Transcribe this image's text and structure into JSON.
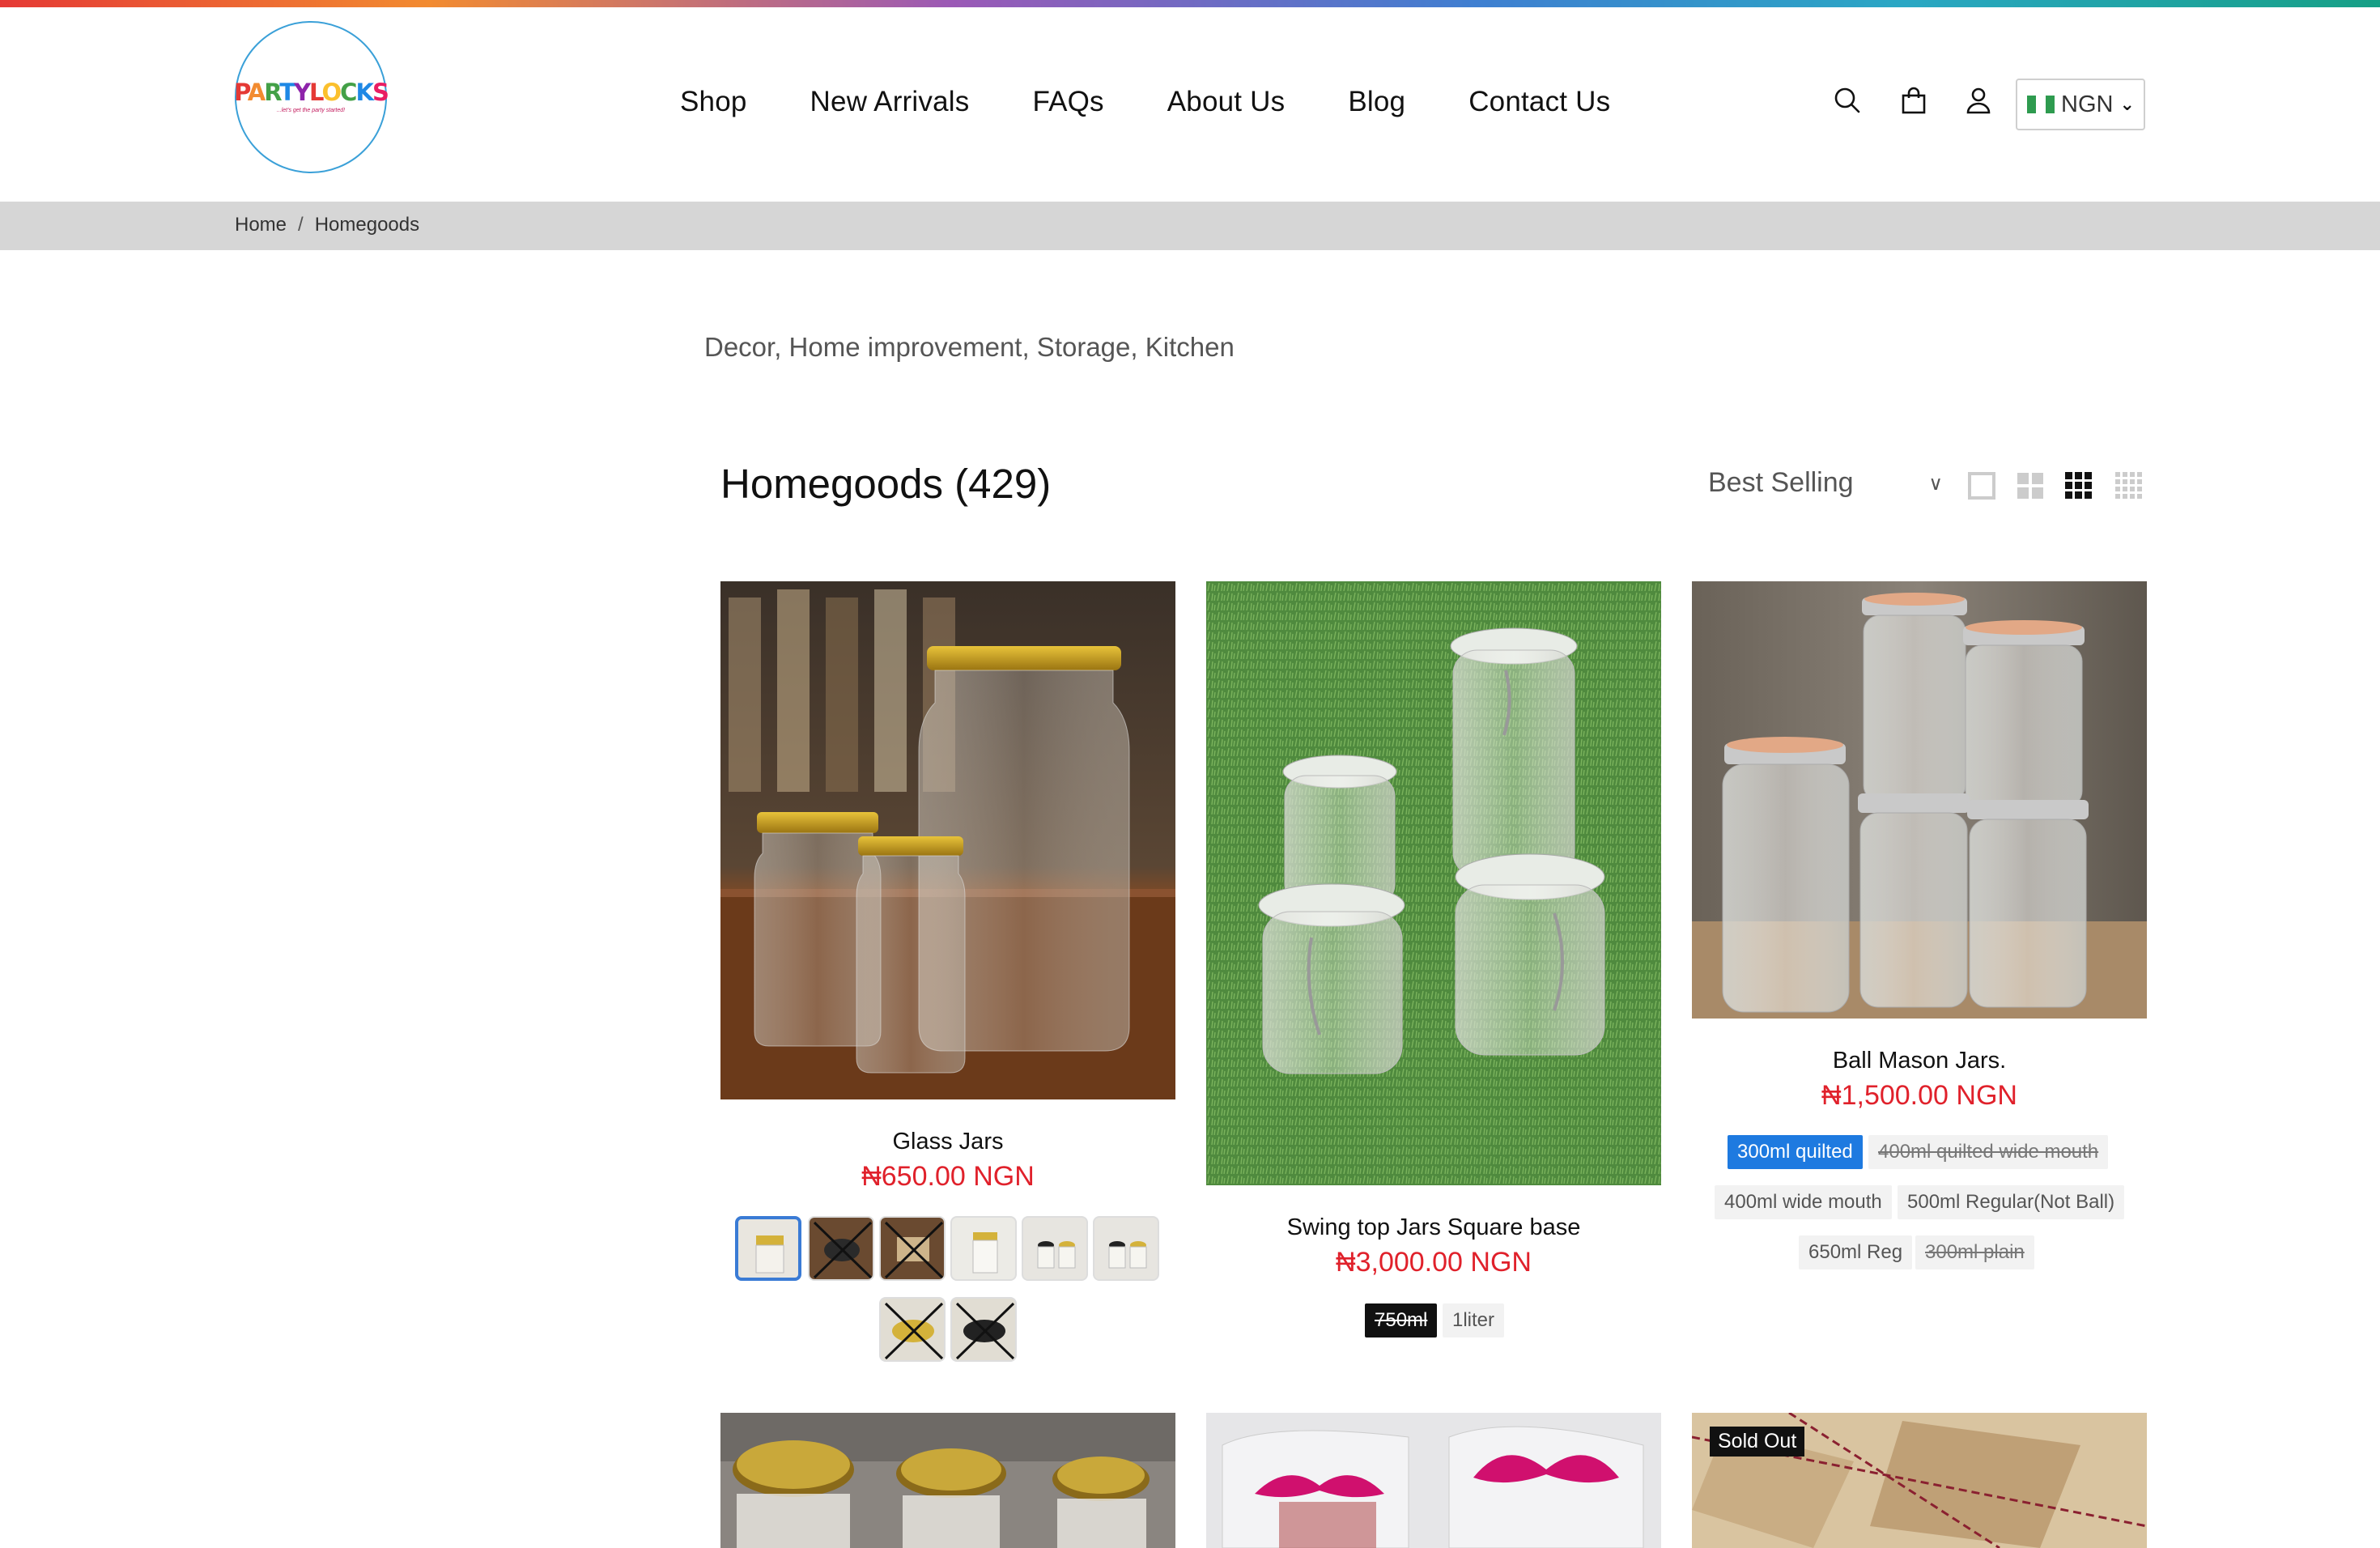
{
  "header": {
    "logo_text": "PARTYLOCKS",
    "logo_tagline": "...let's get the party started!",
    "nav": [
      "Shop",
      "New Arrivals",
      "FAQs",
      "About Us",
      "Blog",
      "Contact Us"
    ],
    "currency": "NGN",
    "icons": [
      "search-icon",
      "bag-icon",
      "user-icon"
    ]
  },
  "breadcrumb": {
    "home": "Home",
    "sep": "/",
    "current": "Homegoods"
  },
  "collection": {
    "description": "Decor, Home improvement, Storage, Kitchen",
    "title": "Homegoods (429)",
    "sort": "Best Selling"
  },
  "products": [
    {
      "name": "Glass Jars",
      "price": "₦650.00 NGN",
      "swatches": 8
    },
    {
      "name": "Swing top Jars Square base",
      "price": "₦3,000.00 NGN",
      "variants": [
        "750ml",
        "1liter"
      ]
    },
    {
      "name": "Ball Mason Jars.",
      "price": "₦1,500.00 NGN",
      "variants": [
        "300ml quilted",
        "400ml quilted wide mouth",
        "400ml wide mouth",
        "500ml Regular(Not Ball)",
        "650ml Reg",
        "300ml plain"
      ]
    }
  ],
  "badges": {
    "sold_out": "Sold Out"
  },
  "colors": {
    "price": "#e0212b",
    "accent": "#1e7ae0",
    "breadcrumb_bg": "#d6d6d6"
  }
}
